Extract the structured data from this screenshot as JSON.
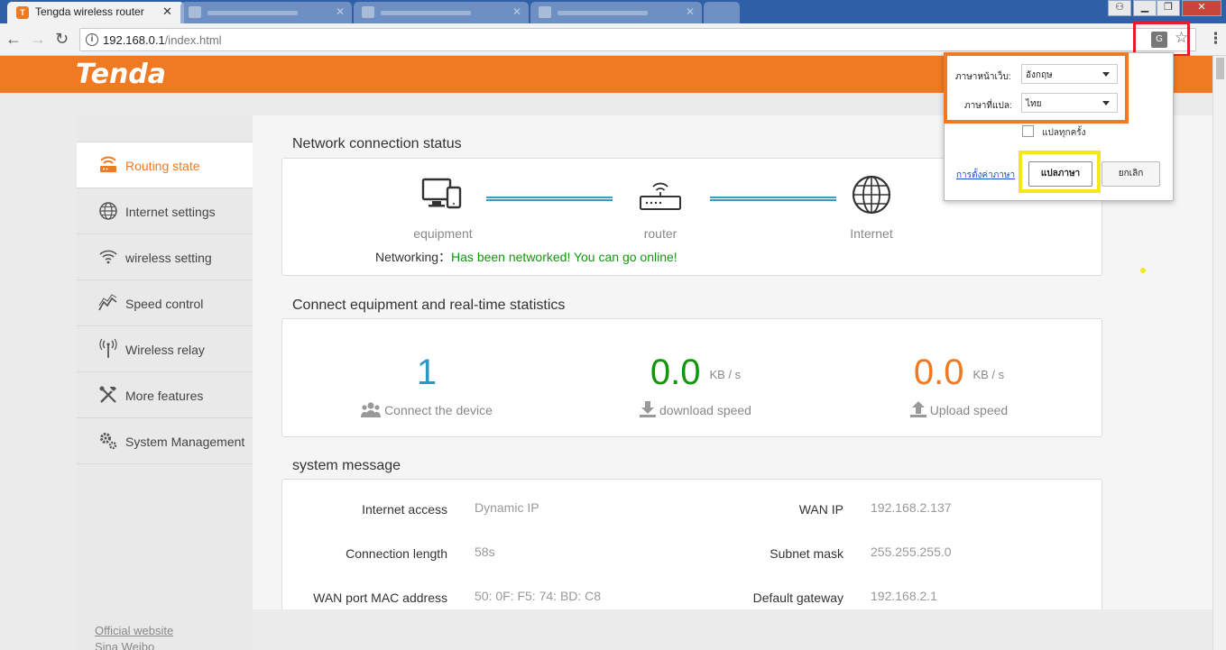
{
  "browser": {
    "active_tab_title": "Tengda wireless router",
    "tab_close": "✕",
    "url_host": "192.168.0.1",
    "url_path": "/index.html"
  },
  "header": {
    "logo": "Tenda"
  },
  "sidebar": {
    "items": [
      {
        "label": "Routing state",
        "icon": "router-icon",
        "active": true
      },
      {
        "label": "Internet settings",
        "icon": "globe-icon"
      },
      {
        "label": "wireless setting",
        "icon": "wifi-icon"
      },
      {
        "label": "Speed control",
        "icon": "speed-chart-icon"
      },
      {
        "label": "Wireless relay",
        "icon": "antenna-icon"
      },
      {
        "label": "More features",
        "icon": "tools-icon"
      },
      {
        "label": "System Management",
        "icon": "gears-icon"
      }
    ],
    "links": [
      "Official website",
      "Sina Weibo"
    ]
  },
  "network": {
    "title": "Network connection status",
    "nodes": [
      "equipment",
      "router",
      "Internet"
    ],
    "status_label": "Networking",
    "status_sep": "：",
    "status_value": "Has been networked! You can go online!"
  },
  "stats": {
    "title": "Connect equipment and real-time statistics",
    "devices": {
      "value": "1",
      "label": "Connect the device",
      "color": "#2b97c7"
    },
    "download": {
      "value": "0.0",
      "unit": "KB / s",
      "label": "download speed",
      "color": "#13960e"
    },
    "upload": {
      "value": "0.0",
      "unit": "KB / s",
      "label": "Upload speed",
      "color": "#f07a23"
    }
  },
  "system": {
    "title": "system message",
    "rows": [
      {
        "label": "Internet access",
        "value": "Dynamic IP"
      },
      {
        "label": "Connection length",
        "value": "58s"
      },
      {
        "label": "WAN port MAC address",
        "value": "50: 0F: F5: 74: BD: C8"
      }
    ],
    "rows_right": [
      {
        "label": "WAN IP",
        "value": "192.168.2.137"
      },
      {
        "label": "Subnet mask",
        "value": "255.255.255.0"
      },
      {
        "label": "Default gateway",
        "value": "192.168.2.1"
      }
    ]
  },
  "translate_popup": {
    "page_lang_label": "ภาษาหน้าเว็บ:",
    "page_lang_value": "อังกฤษ",
    "target_lang_label": "ภาษาที่แปล:",
    "target_lang_value": "ไทย",
    "always_label": "แปลทุกครั้ง",
    "settings_link": "การตั้งค่าภาษา",
    "translate_button": "แปลภาษา",
    "cancel_button": "ยกเลิก"
  },
  "colors": {
    "brand": "#f07a23",
    "ok_text": "#13960e",
    "highlight_red": "#e0202a",
    "highlight_orange": "#f07a23",
    "highlight_yellow": "#f4e81a"
  }
}
